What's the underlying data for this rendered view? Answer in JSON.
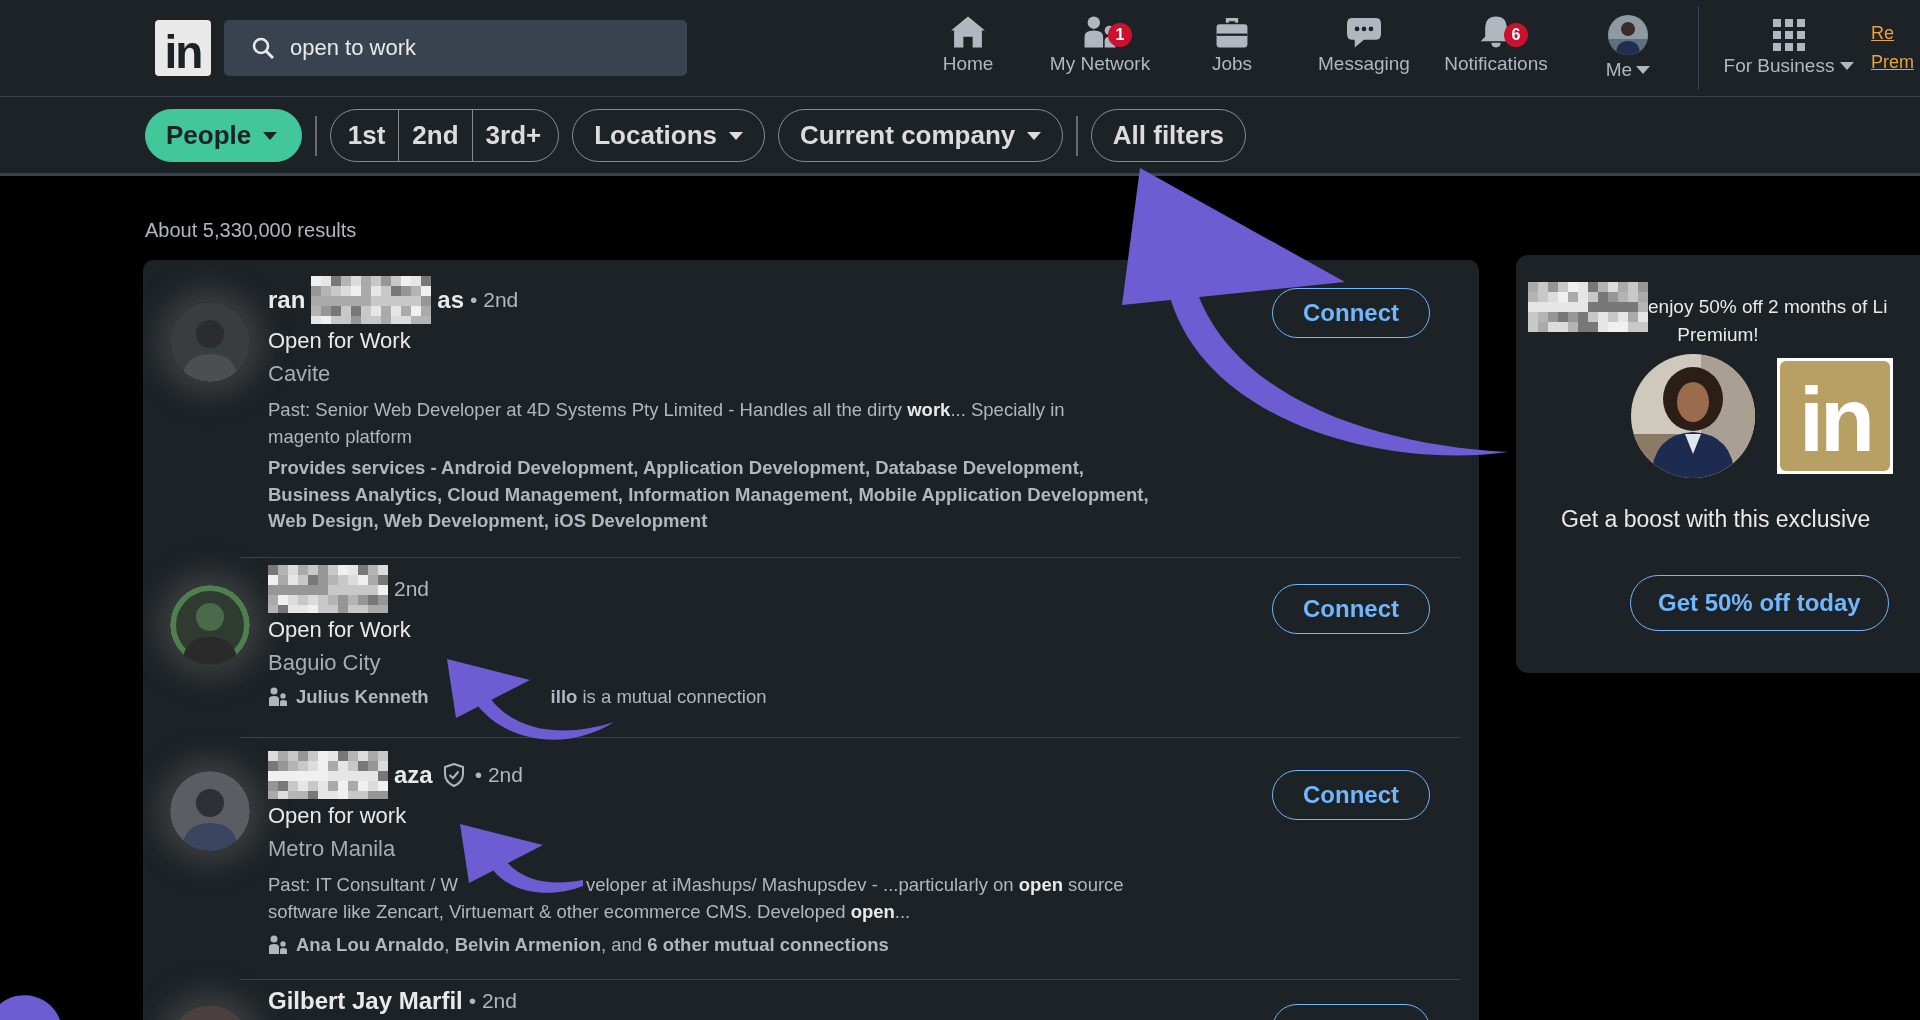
{
  "nav": {
    "logo": "in",
    "search": {
      "value": "open to work"
    },
    "items": [
      {
        "kind": "home",
        "label": "Home"
      },
      {
        "kind": "network",
        "label": "My Network",
        "badge": "1"
      },
      {
        "kind": "jobs",
        "label": "Jobs"
      },
      {
        "kind": "messaging",
        "label": "Messaging"
      },
      {
        "kind": "bell",
        "label": "Notifications",
        "badge": "6"
      },
      {
        "kind": "avatar",
        "label": "Me",
        "dropdown": true
      }
    ],
    "business": {
      "label": "For Business",
      "dropdown": true
    },
    "premium_link": [
      "Re",
      "Prem"
    ]
  },
  "filters": [
    {
      "kind": "pill",
      "label": "People",
      "dropdown": true,
      "selected": true
    },
    {
      "kind": "divider"
    },
    {
      "kind": "group",
      "options": [
        {
          "label": "1st",
          "selected": false
        },
        {
          "label": "2nd",
          "selected": false
        },
        {
          "label": "3rd+",
          "selected": false
        }
      ]
    },
    {
      "kind": "pill",
      "label": "Locations",
      "dropdown": true,
      "selected": false
    },
    {
      "kind": "pill",
      "label": "Current company",
      "dropdown": true,
      "selected": false
    },
    {
      "kind": "divider"
    },
    {
      "kind": "pill",
      "label": "All filters",
      "dropdown": false,
      "selected": false
    }
  ],
  "results_count": "About 5,330,000 results",
  "results": [
    {
      "name_start": "ran",
      "redacted": true,
      "name_end": "as",
      "verified": false,
      "degree": "• 2nd",
      "headline": "Open for Work",
      "location": "Cavite",
      "summary": [
        [
          "Past: Senior Web Developer at 4D Systems Pty Limited - Handles all the dirty **work**... Specially in magento platform"
        ]
      ],
      "services": "Provides services - Android Development, Application Development, Database Development, Business Analytics, Cloud Management, Information Management, Mobile Application Development, Web Design, Web Development, iOS Development",
      "button": "Connect"
    },
    {
      "redacted": true,
      "verified": false,
      "degree": "2nd",
      "headline": "Open for Work",
      "location": "Baguio City",
      "mutual": [
        "**Julius Kenneth**",
        "**illo** is a mutual connection"
      ],
      "button": "Connect"
    },
    {
      "redacted": true,
      "name_end": "aza",
      "verified": true,
      "degree": "• 2nd",
      "headline": "Open for work",
      "location": "Metro Manila",
      "summary": [
        [
          "Past: IT Consultant / W",
          "veloper at iMashups/ Mashupsdev - ...particularly on **open** source"
        ],
        [
          "software like Zencart, Virtuemart & other ecommerce CMS. Developed **open**..."
        ]
      ],
      "mutual": [
        "**Ana Lou Arnaldo**, **Belvin Armenion**, and **6 other mutual connections**"
      ],
      "button": "Connect"
    },
    {
      "name_start": "Gilbert Jay Marfil",
      "redacted": false,
      "verified": false,
      "degree": "• 2nd",
      "button_outline": true
    }
  ],
  "ad": {
    "redacted": true,
    "headline": [
      "enjoy 50% off 2 months of Li",
      "Premium!"
    ],
    "logo": "in",
    "body": "Get a boost with this exclusive",
    "button": "Get 50% off today"
  }
}
